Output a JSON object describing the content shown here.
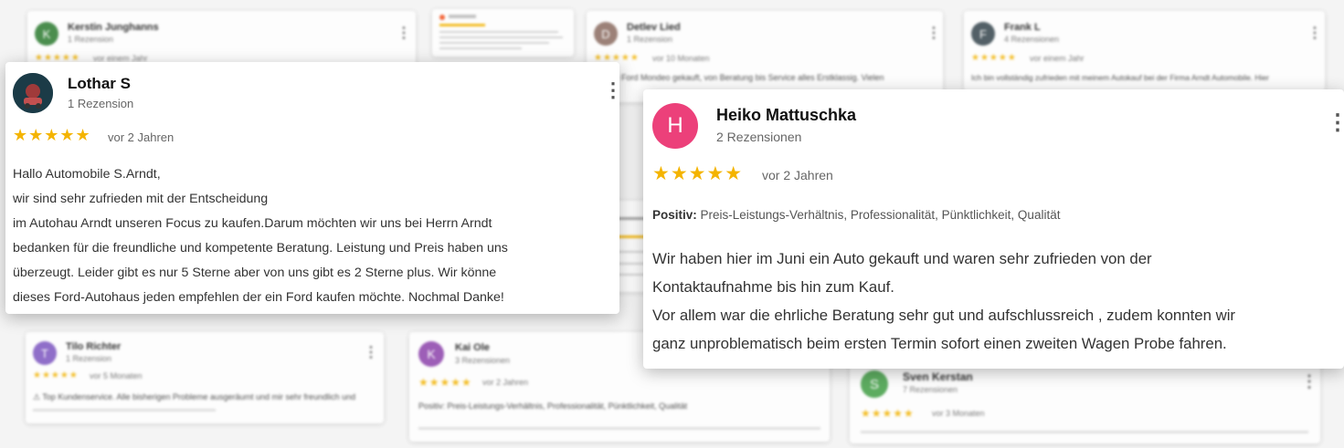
{
  "bg_reviews": [
    {
      "avatar_letter": "K",
      "avatar_color": "#2e7d32",
      "name": "Kerstin Junghanns",
      "count": "1 Rezension",
      "stars": "★★★★★",
      "when": "vor einem Jahr",
      "text": ""
    },
    {
      "avatar_letter": "D",
      "avatar_color": "#8d6e63",
      "name": "Detlev Lied",
      "count": "1 Rezension",
      "stars": "★★★★★",
      "when": "vor 10 Monaten",
      "text": "...habe Ford Mondeo gekauft, von Beratung bis Service alles Erstklassig. Vielen"
    },
    {
      "avatar_letter": "F",
      "avatar_color": "#37474f",
      "name": "Frank L",
      "count": "4 Rezensionen",
      "stars": "★★★★★",
      "when": "vor einem Jahr",
      "text": "Ich bin vollständig zufrieden mit meinem Autokauf bei der Firma Arndt Automobile. Hier"
    },
    {
      "avatar_letter": "T",
      "avatar_color": "#7e57c2",
      "name": "Tilo Richter",
      "count": "1 Rezension",
      "stars": "★★★★★",
      "when": "vor 5 Monaten",
      "text": "⚠ Top Kundenservice. Alle bisherigen Probleme ausgeräumt und mir sehr freundlich und"
    },
    {
      "avatar_letter": "K",
      "avatar_color": "#8e44ad",
      "name": "Kai Ole",
      "count": "3 Rezensionen",
      "stars": "★★★★★",
      "when": "vor 2 Jahren",
      "text": "Positiv: Preis-Leistungs-Verhältnis, Professionalität, Pünktlichkeit, Qualität"
    },
    {
      "avatar_letter": "S",
      "avatar_color": "#43a047",
      "name": "Sven Kerstan",
      "count": "7 Rezensionen",
      "stars": "★★★★★",
      "when": "vor 3 Monaten",
      "text": ""
    }
  ],
  "review_lothar": {
    "name": "Lothar S",
    "count": "1 Rezension",
    "stars": "★★★★★",
    "when": "vor 2 Jahren",
    "lines": [
      "Hallo Automobile S.Arndt,",
      "wir sind sehr zufrieden mit der Entscheidung",
      "im Autohau Arndt unseren Focus zu kaufen.Darum möchten wir uns bei Herrn Arndt",
      "bedanken für die freundliche und kompetente Beratung. Leistung und Preis haben uns",
      "überzeugt. Leider gibt es nur 5 Sterne aber von uns gibt es 2 Sterne plus. Wir könne",
      "dieses Ford-Autohaus jeden empfehlen der ein Ford kaufen möchte. Nochmal Danke!"
    ]
  },
  "review_heiko": {
    "avatar_letter": "H",
    "avatar_color": "#ec407a",
    "name": "Heiko Mattuschka",
    "count": "2 Rezensionen",
    "stars": "★★★★★",
    "when": "vor 2 Jahren",
    "positive_label": "Positiv:",
    "positive_text": " Preis-Leistungs-Verhältnis, Professionalität, Pünktlichkeit, Qualität",
    "lines": [
      "Wir haben hier im Juni ein Auto gekauft und waren sehr zufrieden von der",
      "Kontaktaufnahme bis hin zum Kauf.",
      "Vor allem war die ehrliche Beratung sehr gut und aufschlussreich , zudem konnten wir",
      "ganz unproblematisch beim ersten Termin sofort einen zweiten Wagen Probe fahren."
    ]
  },
  "menu_glyph": "⋮"
}
